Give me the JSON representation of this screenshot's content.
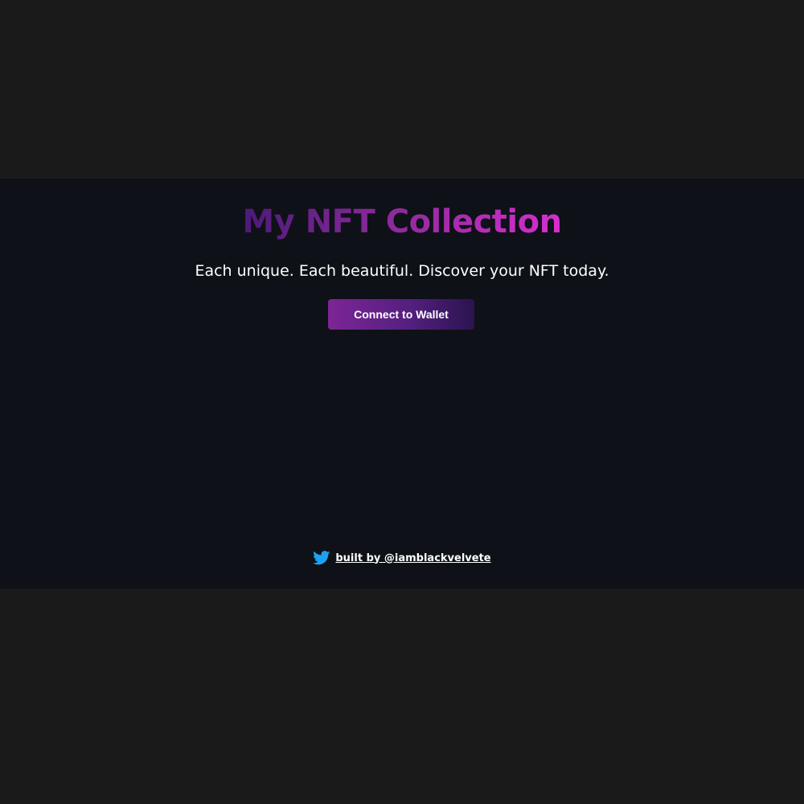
{
  "header": {
    "title": "My NFT Collection",
    "subtitle": "Each unique. Each beautiful. Discover your NFT today."
  },
  "actions": {
    "connect_label": "Connect to Wallet"
  },
  "footer": {
    "icon": "twitter-icon",
    "link_text": "built by @iamblackvelvete"
  },
  "colors": {
    "page_bg": "#1a1a1a",
    "app_bg": "#0e1117",
    "title_gradient_start": "#4b1a78",
    "title_gradient_end": "#d62fcf",
    "button_gradient_start": "#7d2596",
    "button_gradient_end": "#2b1350",
    "twitter_blue": "#1da1f2"
  }
}
